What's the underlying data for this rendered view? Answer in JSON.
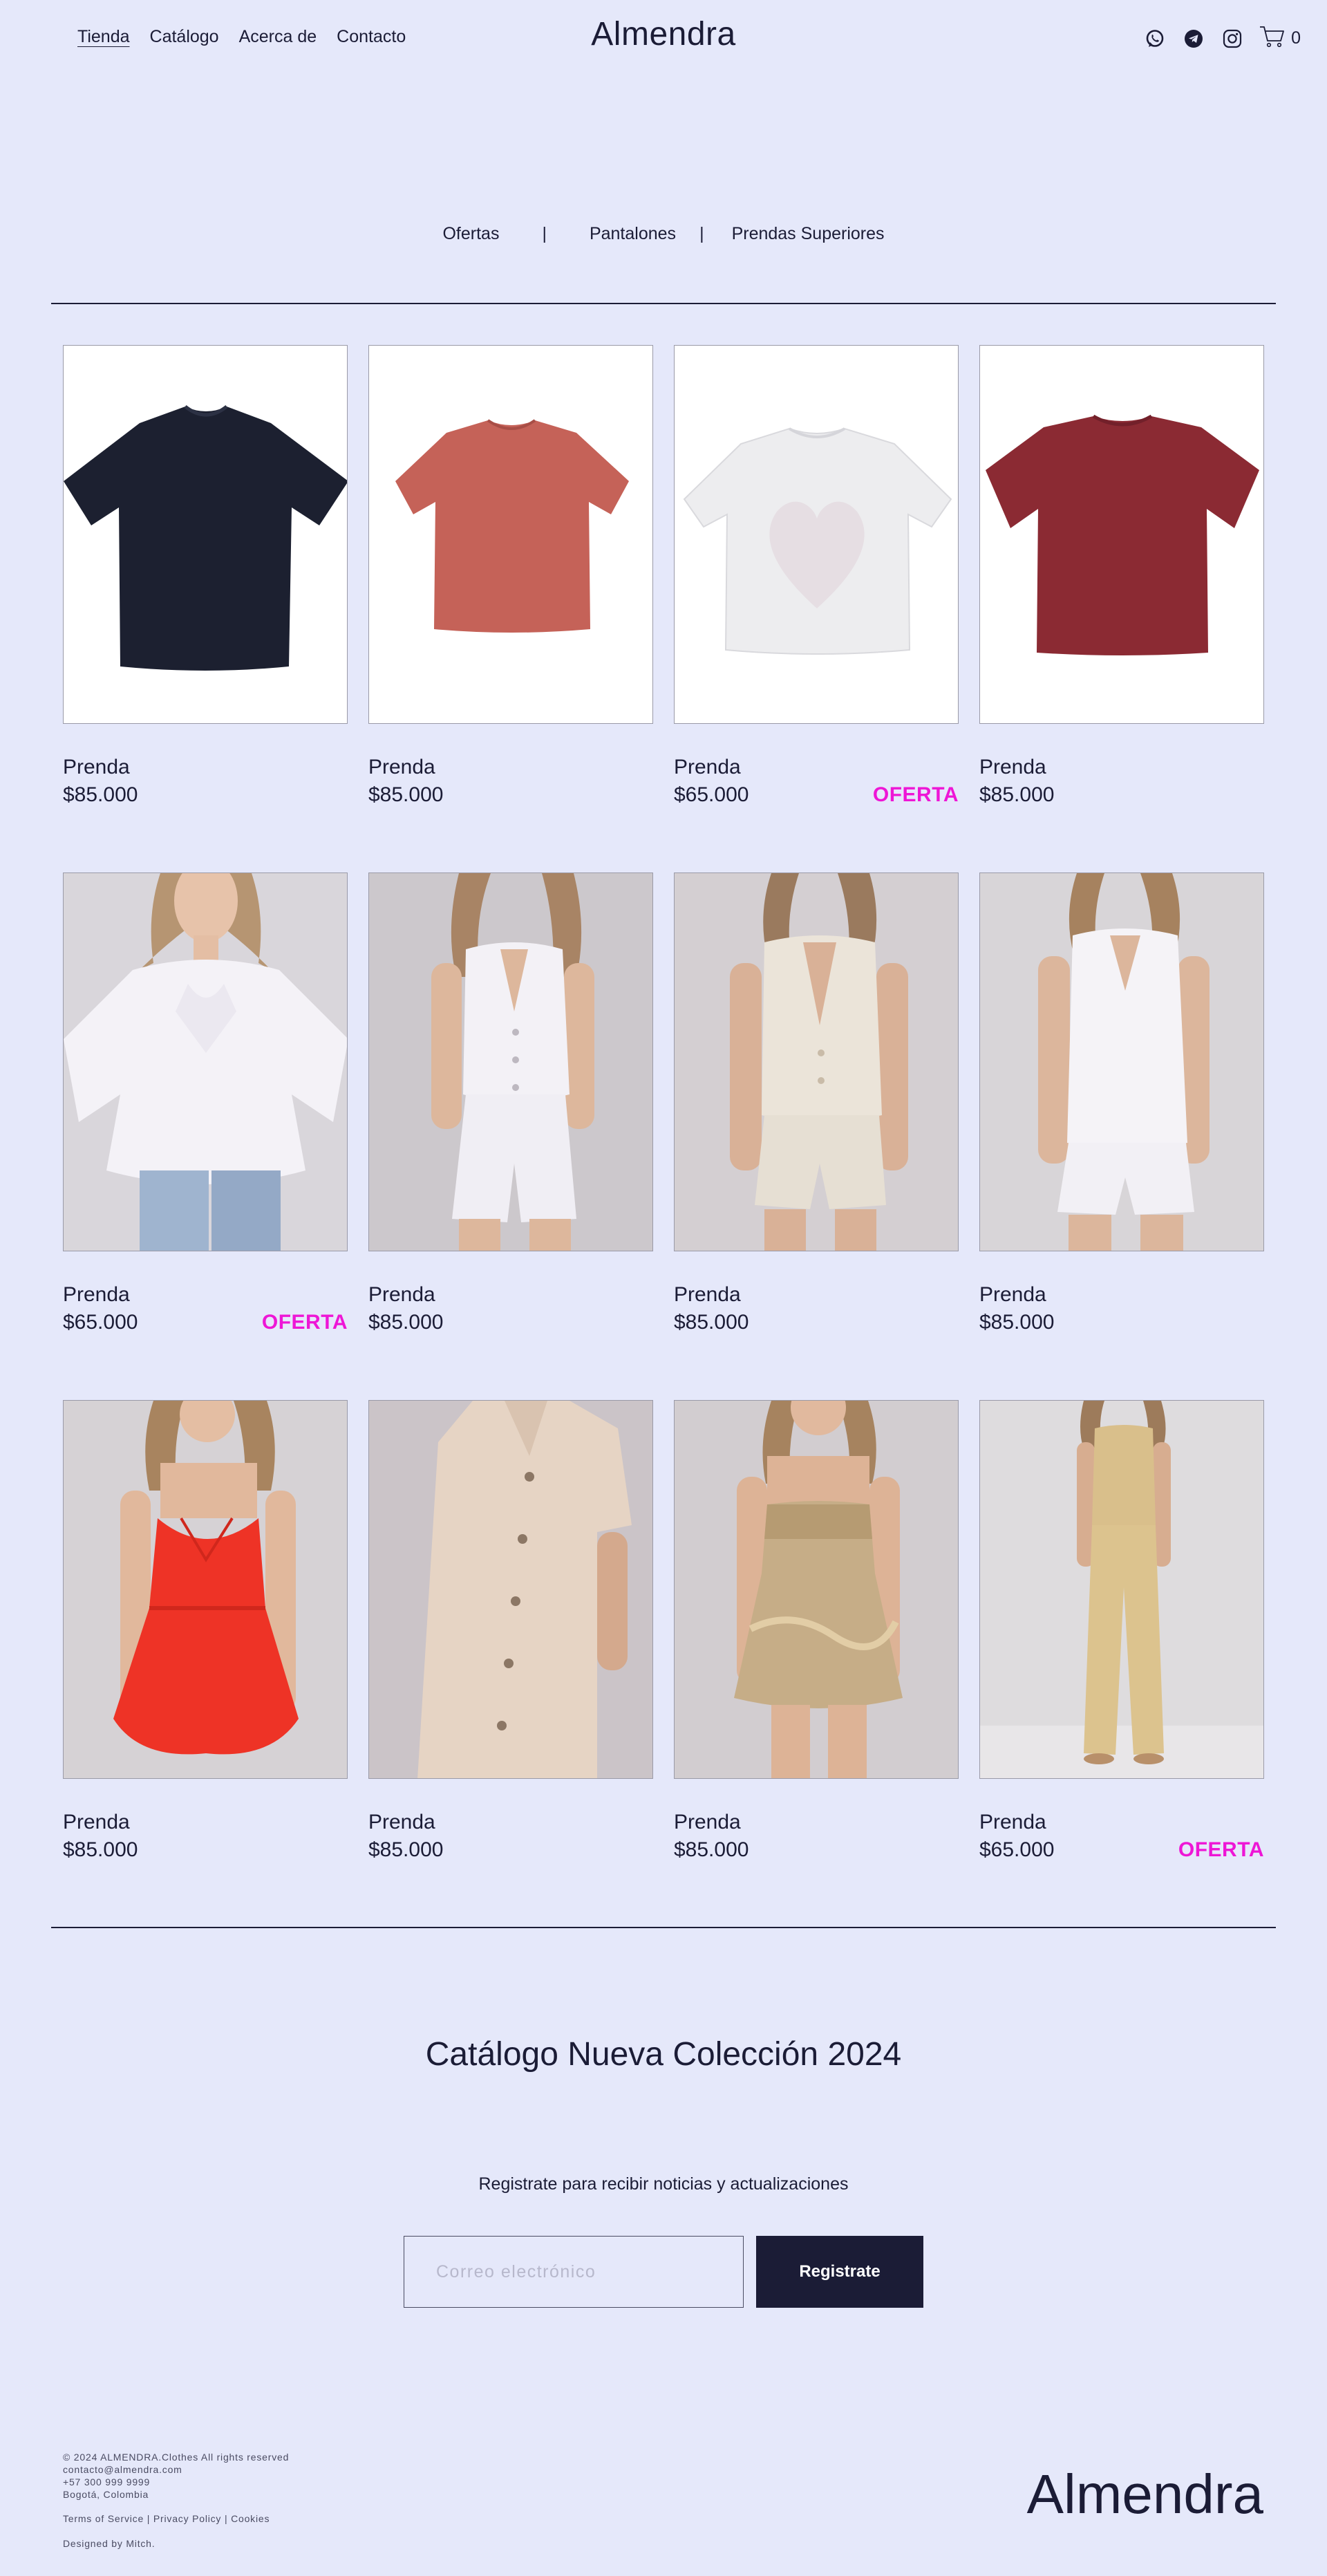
{
  "header": {
    "nav": [
      "Tienda",
      "Catálogo",
      "Acerca de",
      "Contacto"
    ],
    "brand": "Almendra",
    "icons": [
      "whatsapp-icon",
      "telegram-icon",
      "instagram-icon",
      "cart-icon"
    ],
    "cart_count": "0"
  },
  "filters": {
    "items": [
      "Ofertas",
      "Pantalones",
      "Prendas Superiores"
    ],
    "separator": "|"
  },
  "products": [
    {
      "name": "Prenda",
      "price": "$85.000",
      "badge": "",
      "image": "tshirt-dark-navy"
    },
    {
      "name": "Prenda",
      "price": "$85.000",
      "badge": "",
      "image": "tshirt-terracotta"
    },
    {
      "name": "Prenda",
      "price": "$65.000",
      "badge": "OFERTA",
      "image": "tshirt-white-heart"
    },
    {
      "name": "Prenda",
      "price": "$85.000",
      "badge": "",
      "image": "tshirt-burgundy"
    },
    {
      "name": "Prenda",
      "price": "$65.000",
      "badge": "OFERTA",
      "image": "model-white-blouse-jeans"
    },
    {
      "name": "Prenda",
      "price": "$85.000",
      "badge": "",
      "image": "model-white-vest-shorts"
    },
    {
      "name": "Prenda",
      "price": "$85.000",
      "badge": "",
      "image": "model-beige-vest-shorts"
    },
    {
      "name": "Prenda",
      "price": "$85.000",
      "badge": "",
      "image": "model-white-vest-set"
    },
    {
      "name": "Prenda",
      "price": "$85.000",
      "badge": "",
      "image": "model-red-dress"
    },
    {
      "name": "Prenda",
      "price": "$85.000",
      "badge": "",
      "image": "model-beige-shirt-dress"
    },
    {
      "name": "Prenda",
      "price": "$85.000",
      "badge": "",
      "image": "model-gold-strapless-dress"
    },
    {
      "name": "Prenda",
      "price": "$65.000",
      "badge": "OFERTA",
      "image": "model-beige-vest-pants"
    }
  ],
  "newsletter": {
    "title": "Catálogo Nueva Colección 2024",
    "subtitle": "Registrate para recibir noticias y actualizaciones",
    "placeholder": "Correo electrónico",
    "button": "Registrate"
  },
  "footer": {
    "copyright": "© 2024 ALMENDRA.Clothes All rights reserved",
    "email": "contacto@almendra.com",
    "phone": "+57 300 999 9999",
    "location": "Bogotá, Colombia",
    "links": [
      "Terms of Service",
      "Privacy Policy",
      "Cookies"
    ],
    "link_separator": "|",
    "credit": "Designed by Mitch.",
    "brand": "Almendra"
  },
  "colors": {
    "background": "#e5e8fa",
    "text": "#1b1c36",
    "offer": "#ee16d6",
    "button": "#1b1c36"
  }
}
